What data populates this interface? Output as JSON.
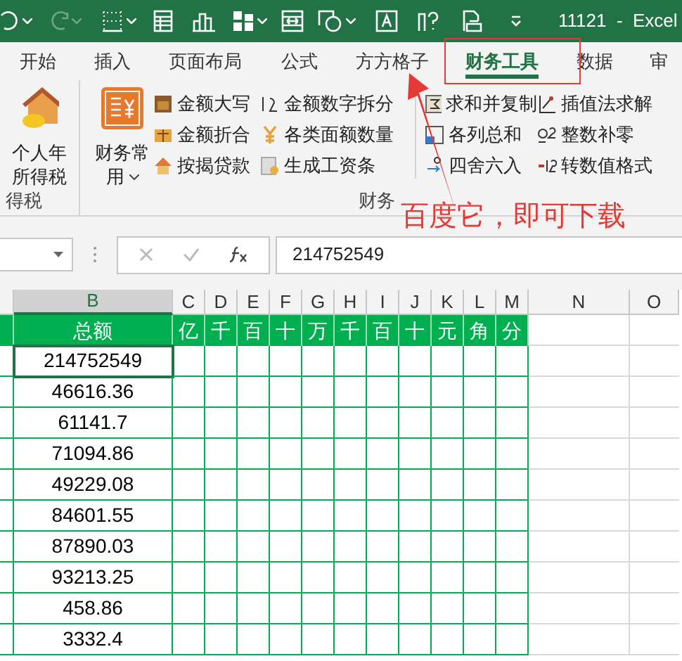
{
  "title_bar": {
    "title": "11121  -  Excel",
    "redo_disabled": true
  },
  "ribbon_tabs": [
    {
      "label": "开始",
      "selected": false
    },
    {
      "label": "插入",
      "selected": false
    },
    {
      "label": "页面布局",
      "selected": false
    },
    {
      "label": "公式",
      "selected": false
    },
    {
      "label": "方方格子",
      "selected": false
    },
    {
      "label": "财务工具",
      "selected": true
    },
    {
      "label": "数据",
      "selected": false
    },
    {
      "label": "审",
      "selected": false
    }
  ],
  "ribbon_groups": [
    {
      "label": "得税",
      "large_buttons": [
        {
          "lines": [
            "个人年",
            "所得税"
          ],
          "dropdown": false
        }
      ]
    },
    {
      "label": "财务",
      "large_buttons": [
        {
          "lines": [
            "财务常",
            "用"
          ],
          "dropdown": true
        }
      ],
      "small_buttons": [
        {
          "label": "金额大写"
        },
        {
          "label": "金额折合"
        },
        {
          "label": "按揭贷款"
        },
        {
          "label": "金额数字拆分"
        },
        {
          "label": "各类面额数量"
        },
        {
          "label": "生成工资条"
        },
        {
          "label": "求和并复制"
        },
        {
          "label": "各列总和"
        },
        {
          "label": "四舍六入"
        },
        {
          "label": "插值法求解"
        },
        {
          "label": "整数补零"
        },
        {
          "label": "转数值格式"
        }
      ]
    }
  ],
  "annotation": {
    "text": "百度它，即可下载"
  },
  "formula_bar": {
    "value": "214752549"
  },
  "sheet": {
    "columns": [
      {
        "label": "B",
        "selected": true
      },
      {
        "label": "C",
        "selected": false
      },
      {
        "label": "D",
        "selected": false
      },
      {
        "label": "E",
        "selected": false
      },
      {
        "label": "F",
        "selected": false
      },
      {
        "label": "G",
        "selected": false
      },
      {
        "label": "H",
        "selected": false
      },
      {
        "label": "I",
        "selected": false
      },
      {
        "label": "J",
        "selected": false
      },
      {
        "label": "K",
        "selected": false
      },
      {
        "label": "L",
        "selected": false
      },
      {
        "label": "M",
        "selected": false
      },
      {
        "label": "N",
        "selected": false
      },
      {
        "label": "O",
        "selected": false
      }
    ],
    "header_row": [
      "总额",
      "亿",
      "千",
      "百",
      "十",
      "万",
      "千",
      "百",
      "十",
      "元",
      "角",
      "分"
    ],
    "rows": [
      {
        "total": "214752549",
        "selected": true
      },
      {
        "total": "46616.36",
        "selected": false
      },
      {
        "total": "61141.7",
        "selected": false
      },
      {
        "total": "71094.86",
        "selected": false
      },
      {
        "total": "49229.08",
        "selected": false
      },
      {
        "total": "84601.55",
        "selected": false
      },
      {
        "total": "87890.03",
        "selected": false
      },
      {
        "total": "93213.25",
        "selected": false
      },
      {
        "total": "458.86",
        "selected": false
      },
      {
        "total": "3332.4",
        "selected": false
      }
    ]
  }
}
